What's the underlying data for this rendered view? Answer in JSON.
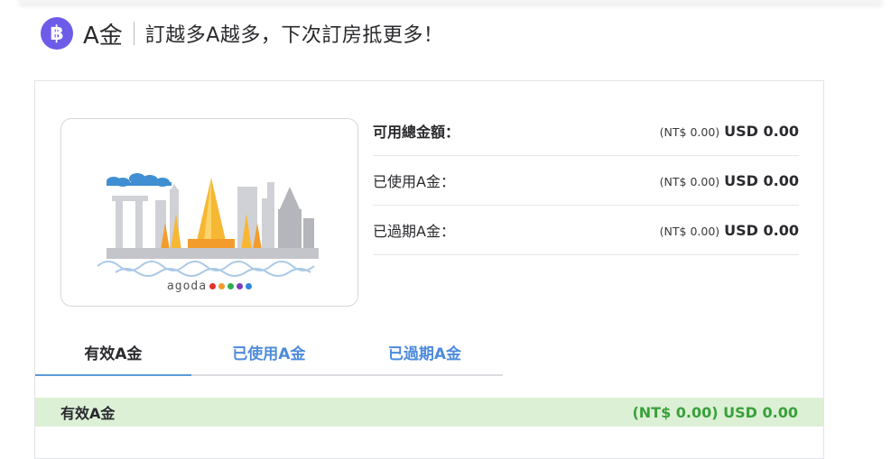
{
  "header": {
    "icon": "agoda-cash-coin-icon",
    "icon_glyph": "฿",
    "brand": "A金",
    "tagline": "訂越多A越多，下次訂房抵更多！"
  },
  "card": {
    "image": "city-skyline-illustration",
    "logo_text": "agoda",
    "dot_colors": [
      "#e5312a",
      "#f39c2b",
      "#2fad4f",
      "#7a3fb6",
      "#2e86de"
    ]
  },
  "balances": [
    {
      "label": "可用總金額：",
      "ntd": "(NT$ 0.00)",
      "usd": "USD 0.00"
    },
    {
      "label": "已使用A金：",
      "ntd": "(NT$ 0.00)",
      "usd": "USD 0.00"
    },
    {
      "label": "已過期A金：",
      "ntd": "(NT$ 0.00)",
      "usd": "USD 0.00"
    }
  ],
  "tabs": [
    {
      "label": "有效A金",
      "active": true
    },
    {
      "label": "已使用A金",
      "active": false
    },
    {
      "label": "已過期A金",
      "active": false
    }
  ],
  "summary": {
    "label": "有效A金",
    "amount": "(NT$ 0.00) USD 0.00"
  },
  "colors": {
    "coin": "#6d5ce8",
    "tab_link": "#4d8bdc",
    "summary_bg": "#dcf0d6",
    "summary_amount": "#3aa03a"
  }
}
